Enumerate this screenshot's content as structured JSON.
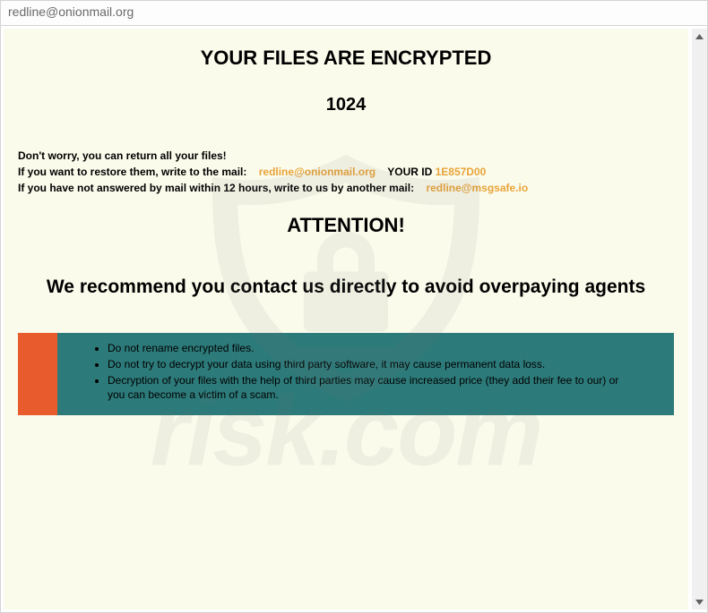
{
  "titlebar": {
    "text": "redline@onionmail.org"
  },
  "heading": {
    "main": "YOUR FILES ARE ENCRYPTED",
    "number": "1024"
  },
  "info": {
    "line1": "Don't worry, you can return all your files!",
    "line2_prefix": "If you want to restore them, write to the mail:",
    "email1": "redline@onionmail.org",
    "your_id_label": "YOUR ID",
    "your_id": "1E857D00",
    "line3_prefix": "If you have not answered by mail within 12 hours, write to us by another mail:",
    "email2": "redline@msgsafe.io"
  },
  "attention": {
    "title": "ATTENTION!",
    "recommend": "We recommend you contact us directly to avoid overpaying agents"
  },
  "warnings": {
    "items": [
      "Do not rename encrypted files.",
      "Do not try to decrypt your data using third party software, it may cause permanent data loss.",
      "Decryption of your files with the help of third parties may cause increased price (they add their fee to our) or you can become a victim of a scam."
    ]
  },
  "watermark": {
    "text": "risk.com"
  }
}
